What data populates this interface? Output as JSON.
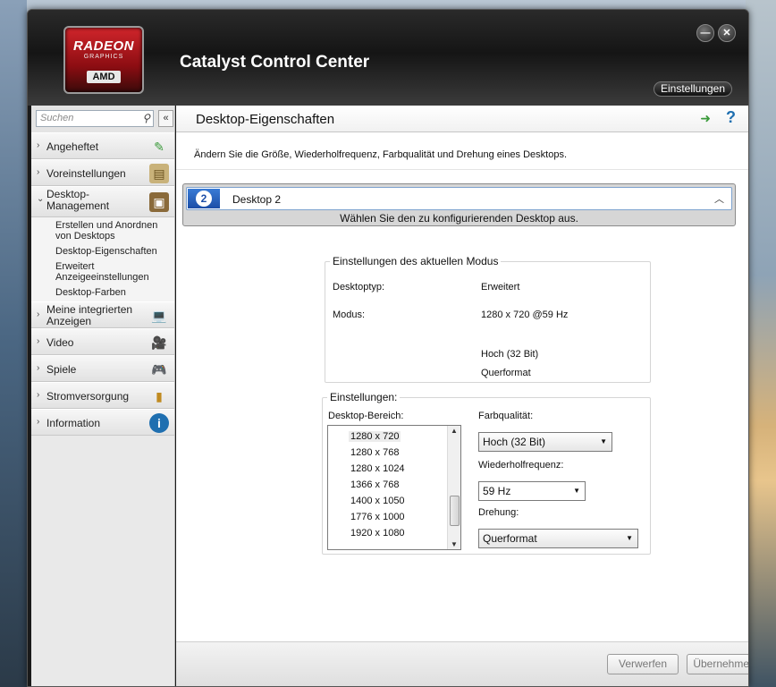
{
  "app": {
    "title": "Catalyst Control Center",
    "logo_line1": "RADEON",
    "logo_line2": "GRAPHICS",
    "logo_line3": "AMD",
    "settings_label": "Einstellungen",
    "minimize_icon": "minimize-icon",
    "close_icon": "close-icon"
  },
  "sidebar": {
    "search_placeholder": "Suchen",
    "items": [
      {
        "label": "Angeheftet",
        "icon": "pin-icon"
      },
      {
        "label": "Voreinstellungen",
        "icon": "presets-icon"
      },
      {
        "label": "Desktop-\nManagement",
        "icon": "desktop-management-icon",
        "expanded": true
      },
      {
        "label": "Meine integrierten Anzeigen",
        "icon": "laptop-icon"
      },
      {
        "label": "Video",
        "icon": "video-camera-icon"
      },
      {
        "label": "Spiele",
        "icon": "gamepad-icon"
      },
      {
        "label": "Stromversorgung",
        "icon": "battery-icon"
      },
      {
        "label": "Information",
        "icon": "info-icon"
      }
    ],
    "subitems": [
      "Erstellen und Anordnen von Desktops",
      "Desktop-Eigenschaften",
      "Erweitert Anzeigeeinstellungen",
      "Desktop-Farben"
    ]
  },
  "main": {
    "title": "Desktop-Eigenschaften",
    "description": "Ändern Sie die Größe, Wiederholfrequenz, Farbqualität und Drehung eines Desktops.",
    "desktop_selector": {
      "number": "2",
      "name": "Desktop 2",
      "hint": "Wählen Sie den zu konfigurierenden Desktop aus."
    },
    "current_mode": {
      "legend": "Einstellungen des aktuellen Modus",
      "desktop_type_label": "Desktoptyp:",
      "desktop_type_value": "Erweitert",
      "mode_label": "Modus:",
      "mode_value": "1280 x  720 @59 Hz",
      "color_value": "Hoch (32 Bit)",
      "orientation_value": "Querformat"
    },
    "settings": {
      "legend": "Einstellungen:",
      "desktop_area_label": "Desktop-Bereich:",
      "resolutions": [
        "1280 x  720",
        "1280 x  768",
        "1280 x 1024",
        "1366 x  768",
        "1400 x 1050",
        "1776 x 1000",
        "1920 x 1080"
      ],
      "selected_resolution": "1280 x  720",
      "color_quality_label": "Farbqualität:",
      "color_quality_value": "Hoch (32 Bit)",
      "refresh_label": "Wiederholfrequenz:",
      "refresh_value": "59 Hz",
      "rotation_label": "Drehung:",
      "rotation_value": "Querformat"
    },
    "footer": {
      "discard_label": "Verwerfen",
      "apply_label": "Übernehmen"
    }
  }
}
